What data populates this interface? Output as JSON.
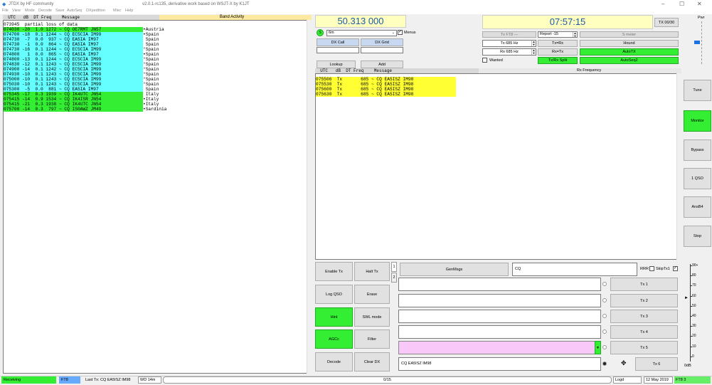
{
  "titlebar": {
    "app": "JTDX  by HF community",
    "version": "v2.0.1-rc135, derivative work based on WSJT-X by K1JT"
  },
  "menu": [
    "File",
    "View",
    "Mode",
    "Decode",
    "Save",
    "AutoSeq",
    "DXpedition",
    "Misc",
    "Help"
  ],
  "band": {
    "title": "Band Activity",
    "header": "  UTC   dB  DT Freq    Message",
    "lines": [
      {
        "t": "073945  partial loss of data",
        "c": "",
        "bg": "#ffffff"
      },
      {
        "t": "074030 -20  1.0 1272 ~ CQ OE7RMT JN57",
        "c": "•Austria",
        "bg": "#33ee33"
      },
      {
        "t": "074700 -18  0.1 1244 ~ CQ EC5CIA IM99",
        "c": "•Spain",
        "bg": "#66ffff"
      },
      {
        "t": "074730  -7  0.0  937 ~ CQ EA5IA IM97",
        "c": " Spain",
        "bg": "#66ffff"
      },
      {
        "t": "074730  -1  0.0  864 ~ CQ EA5IA IM97",
        "c": " Spain",
        "bg": "#66ffff"
      },
      {
        "t": "074730 -16  0.1 1244 ~ CQ EC5CIA IM99",
        "c": "°Spain",
        "bg": "#66ffff"
      },
      {
        "t": "074800   1  0.0  865 ~ CQ EA5IA IM97",
        "c": "•Spain",
        "bg": "#66ffff"
      },
      {
        "t": "074800 -13  0.1 1244 ~ CQ EC5CIA IM99",
        "c": "°Spain",
        "bg": "#66ffff"
      },
      {
        "t": "074830 -12  0.1 1243 ~ CQ EC5CIA IM99",
        "c": "°Spain",
        "bg": "#66ffff"
      },
      {
        "t": "074900 -14  0.1 1242 ~ CQ EC5CIA IM99",
        "c": "°Spain",
        "bg": "#66ffff"
      },
      {
        "t": "074930 -10  0.1 1243 ~ CQ EC5CIA IM99",
        "c": "°Spain",
        "bg": "#66ffff"
      },
      {
        "t": "075000 -10  0.1 1243 ~ CQ EC5CIA IM99",
        "c": "°Spain",
        "bg": "#66ffff"
      },
      {
        "t": "075030 -10  0.1 1243 ~ CQ EC5CIA IM99",
        "c": "°Spain",
        "bg": "#66ffff"
      },
      {
        "t": "075300  -5  0.0  881 ~ CQ EA5IA IM97",
        "c": " Spain",
        "bg": "#66ffff"
      },
      {
        "t": "075345 -17  0.3 1939 ~ CQ IK4UTC JN54",
        "c": " Italy",
        "bg": "#33ee33"
      },
      {
        "t": "075415 -14  0.9 1534 ~ CQ IK4ISR JN54",
        "c": "•Italy",
        "bg": "#33ee33"
      },
      {
        "t": "075415 -21  0.3 1938 ~ CQ IK4UTC JN54",
        "c": "•Italy",
        "bg": "#33ee33"
      },
      {
        "t": "075700 -14  0.3  797 ~ CQ IS0AWZ JM49",
        "c": "•Sardinia",
        "bg": "#33ee33"
      }
    ]
  },
  "freq": "50.313 000",
  "band_sel": "6m",
  "menus": "Menus",
  "s_badge": "S",
  "dxcall": "DX Call",
  "dxgrid": "DX Grid",
  "lookup": "Lookup",
  "add": "Add",
  "clock": "07:57:15",
  "tx_count": "TX 00/30",
  "ctl": {
    "txft": "Tx FT8 —",
    "report": "Report -15",
    "smeter": "S meter",
    "txhz": "Tx  685 Hz",
    "txrx": "Tx=Rx",
    "hound": "Hound",
    "rxhz": "Rx  685 Hz",
    "rxtx": "Rx=Tx",
    "autotx": "AutoTX",
    "wanted": "Wanted",
    "split": "Tx/Rx Split",
    "autoseq": "AutoSeq2"
  },
  "rx": {
    "title": "Rx Frequency",
    "header": "  UTC   dB  DT Freq    Message",
    "lines": [
      "075506  Tx       685 ~ CQ EA5ISZ IM98",
      "075530  Tx       685 ~ CQ EA5ISZ IM98",
      "075600  Tx       685 ~ CQ EA5ISZ IM98",
      "075630  Tx       685 ~ CQ EA5ISZ IM98"
    ]
  },
  "side": {
    "pwr": "Pwr",
    "tune": "Tune",
    "monitor": "Monitor",
    "bypass": "Bypass",
    "qso": "1 QSO",
    "ans": "AnsB4",
    "stop": "Stop"
  },
  "meter": [
    "90+",
    "80",
    "70",
    "60",
    "50",
    "40",
    "30",
    "20",
    "10",
    "0"
  ],
  "meter_unit": "0dB",
  "btns": {
    "enable": "Enable Tx",
    "halt": "Halt Tx",
    "log": "Log QSO",
    "erase": "Erase",
    "hint": "Hint",
    "swl": "SWL mode",
    "agcc": "AGCc",
    "filter": "Filter",
    "decode": "Decode",
    "clear": "Clear DX"
  },
  "tabs": [
    "1",
    "2"
  ],
  "gen": "GenMsgs",
  "cq": "CQ",
  "rrr": "RRR",
  "skip": "SkipTx1",
  "tx": [
    "Tx 1",
    "Tx 2",
    "Tx 3",
    "Tx 4",
    "Tx 5",
    "Tx 6"
  ],
  "tx6": "CQ EA5ISZ IM98",
  "status": {
    "state": "Receiving",
    "mode": "FT8",
    "last": "Last Tx: CQ EA5ISZ IM98",
    "wd": "WD 14m",
    "prog": "0/15",
    "logd": "Logd",
    "date": "12 May 2019",
    "ft": "FT8  3"
  }
}
